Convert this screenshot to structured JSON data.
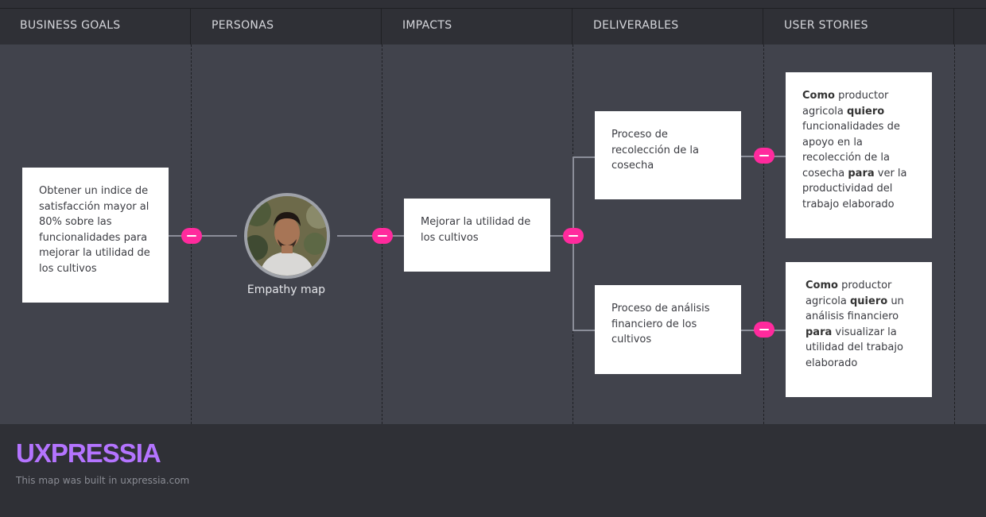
{
  "columns": [
    {
      "label": "BUSINESS GOALS"
    },
    {
      "label": "PERSONAS"
    },
    {
      "label": "IMPACTS"
    },
    {
      "label": "DELIVERABLES"
    },
    {
      "label": "USER STORIES"
    }
  ],
  "business_goal": {
    "text": "Obtener un indice de satisfacción mayor al 80% sobre las funcionalidades para mejorar la utilidad de los cultivos"
  },
  "persona": {
    "label": "Empathy map"
  },
  "impact": {
    "text": "Mejorar la utilidad de los cultivos"
  },
  "deliverables": [
    {
      "text": "Proceso de recolección de la cosecha"
    },
    {
      "text": "Proceso de análisis financiero de los cultivos"
    }
  ],
  "user_stories": [
    {
      "as_kw": "Como",
      "as_text": " productor agricola ",
      "want_kw": "quiero",
      "want_text": " funcionalidades de apoyo en la recolección de la cosecha ",
      "so_kw": "para",
      "so_text": " ver la productividad del trabajo elaborado"
    },
    {
      "as_kw": "Como",
      "as_text": " productor agricola ",
      "want_kw": "quiero",
      "want_text": " un análisis financiero ",
      "so_kw": "para",
      "so_text": " visualizar la utilidad del trabajo elaborado"
    }
  ],
  "footer": {
    "logo": "UXPRESSIA",
    "credit": "This map was built in uxpressia.com"
  },
  "colors": {
    "accent_pill": "#ff2a9d",
    "logo": "#b474ff",
    "canvas": "#41434c",
    "header": "#2f3036"
  }
}
